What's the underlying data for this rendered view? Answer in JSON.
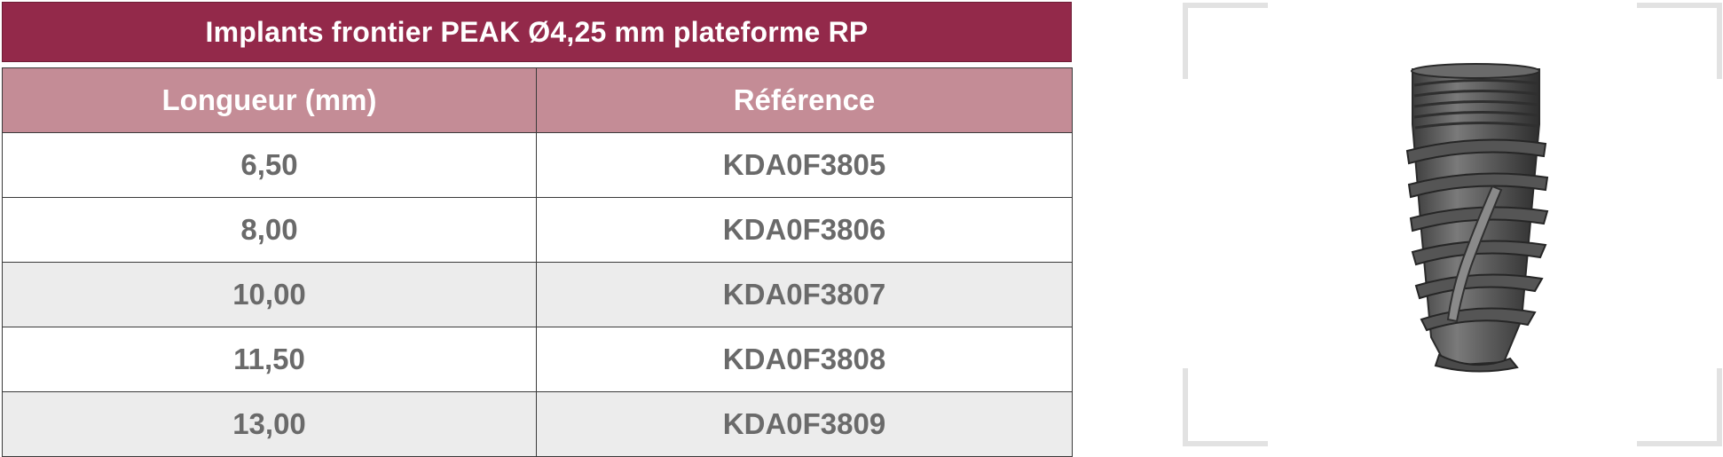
{
  "table": {
    "title": "Implants frontier PEAK Ø4,25 mm plateforme RP",
    "headers": [
      "Longueur (mm)",
      "Référence"
    ],
    "rows": [
      {
        "length": "6,50",
        "reference": "KDA0F3805"
      },
      {
        "length": "8,00",
        "reference": "KDA0F3806"
      },
      {
        "length": "10,00",
        "reference": "KDA0F3807"
      },
      {
        "length": "11,50",
        "reference": "KDA0F3808"
      },
      {
        "length": "13,00",
        "reference": "KDA0F3809"
      }
    ]
  },
  "colors": {
    "title_bg": "#93294a",
    "header_bg": "#c48c96",
    "row_shade": "#ececec",
    "cell_text": "#6a6a6a"
  },
  "image": {
    "subject": "dental-implant-icon"
  }
}
